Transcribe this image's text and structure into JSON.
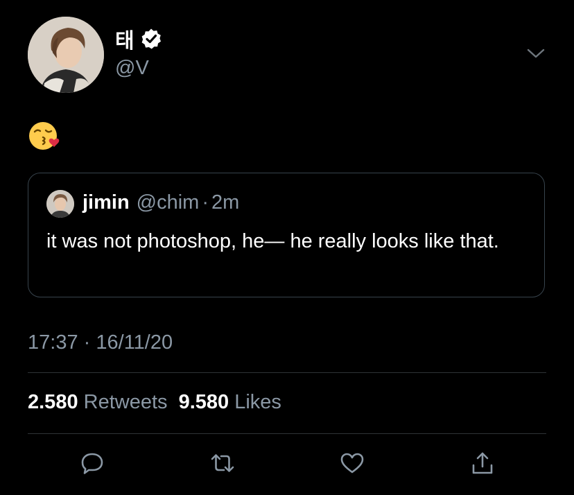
{
  "author": {
    "display_name": "태",
    "handle": "@V",
    "verified": true
  },
  "tweet": {
    "emoji": "😘"
  },
  "quoted_tweet": {
    "display_name": "jimin",
    "handle": "@chim",
    "separator": "·",
    "time": "2m",
    "text": "it was not photoshop, he— he really looks like that."
  },
  "meta": {
    "time": "17:37",
    "separator": "·",
    "date": "16/11/20"
  },
  "stats": {
    "retweets_count": "2.580",
    "retweets_label": "Retweets",
    "likes_count": "9.580",
    "likes_label": "Likes"
  },
  "icons": {
    "verified": "verified-badge-icon",
    "menu": "chevron-down-icon",
    "reply": "reply-icon",
    "retweet": "retweet-icon",
    "like": "heart-icon",
    "share": "share-icon"
  },
  "colors": {
    "background": "#000000",
    "text": "#ffffff",
    "secondary_text": "#8b98a5",
    "border": "#38444d",
    "divider": "#2f3336",
    "accent": "#1d9bf0"
  }
}
